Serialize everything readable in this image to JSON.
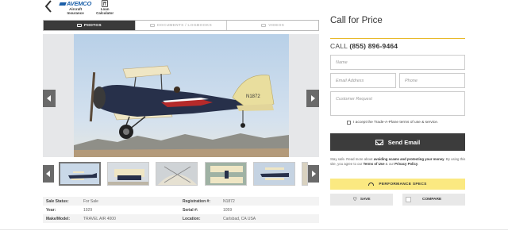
{
  "toolbar": {
    "back_icon": "chevron-left-icon",
    "avemco_logo": "AVEMCO",
    "aircraft_insurance": "Aircraft\nInsurance",
    "loan_calculator": "Loan\nCalculator"
  },
  "tabs": [
    {
      "label": "PHOTOS",
      "active": true
    },
    {
      "label": "DOCUMENTS / LOGBOOKS",
      "active": false
    },
    {
      "label": "VIDEOS",
      "active": false
    }
  ],
  "photo": {
    "tail_number": "N1872",
    "thumbnail_count": 6
  },
  "specs": {
    "rows": [
      {
        "k1": "Sale Status:",
        "v1": "For Sale",
        "k2": "Registration #:",
        "v2": "N1872"
      },
      {
        "k1": "Year:",
        "v1": "1929",
        "k2": "Serial #:",
        "v2": "1059"
      },
      {
        "k1": "Make/Model:",
        "v1": "TRAVEL AIR 4000",
        "k2": "Location:",
        "v2": "Carlsbad, CA USA"
      }
    ]
  },
  "contact": {
    "title": "Call for Price",
    "call_label": "CALL",
    "phone": "(855) 896-9464",
    "name_placeholder": "Name",
    "email_placeholder": "Email Address",
    "phone_placeholder": "Phone",
    "request_placeholder": "Customer Request",
    "terms_label": "I accept the Trade-A-Plane terms of use & service.",
    "send_label": "Send Email",
    "disclaimer_1": "Stay safe. Read more about ",
    "disclaimer_bold": "avoiding scams and protecting your money",
    "disclaimer_2": ". By using this site, you agree to our ",
    "terms_link": "Terms of Use",
    "disclaimer_3": " & our ",
    "privacy_link": "Privacy Policy",
    "disclaimer_4": "."
  },
  "actions": {
    "performance_specs": "PERFORMANCE SPECS",
    "save": "SAVE",
    "compare": "COMPARE"
  },
  "colors": {
    "accent_yellow": "#fbe981",
    "divider_gold": "#e8b92a",
    "dark_button": "#3c3c3c"
  }
}
